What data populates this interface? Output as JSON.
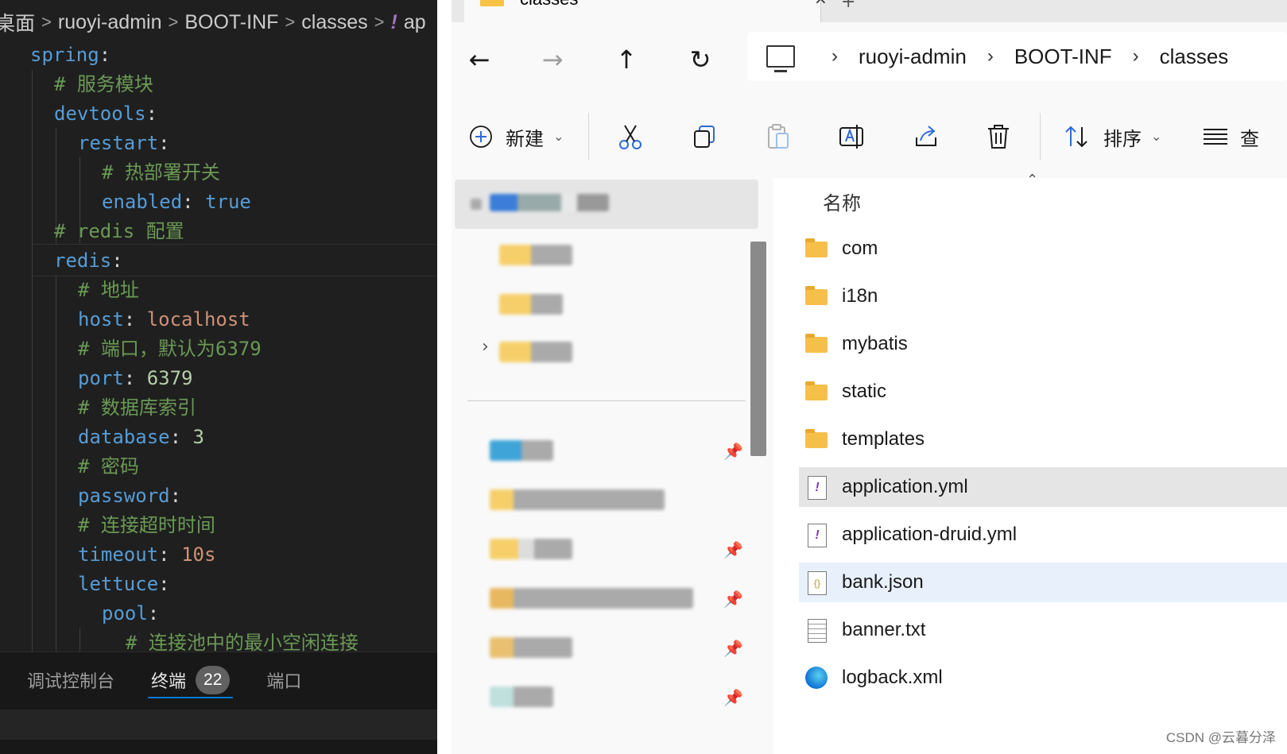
{
  "editor": {
    "breadcrumb": [
      "桌面",
      "ruoyi-admin",
      "BOOT-INF",
      "classes",
      "ap"
    ],
    "breadcrumb_sep": ">",
    "yml_icon": "!",
    "lines": [
      {
        "indent": 1,
        "parts": [
          [
            "k",
            "spring"
          ],
          [
            "p",
            ":"
          ]
        ]
      },
      {
        "indent": 2,
        "parts": [
          [
            "c",
            "# 服务模块"
          ]
        ]
      },
      {
        "indent": 2,
        "parts": [
          [
            "k",
            "devtools"
          ],
          [
            "p",
            ":"
          ]
        ]
      },
      {
        "indent": 3,
        "parts": [
          [
            "k",
            "restart"
          ],
          [
            "p",
            ":"
          ]
        ]
      },
      {
        "indent": 4,
        "parts": [
          [
            "c",
            "# 热部署开关"
          ]
        ]
      },
      {
        "indent": 4,
        "parts": [
          [
            "k",
            "enabled"
          ],
          [
            "p",
            ": "
          ],
          [
            "b",
            "true"
          ]
        ]
      },
      {
        "indent": 2,
        "parts": [
          [
            "c",
            "# redis 配置"
          ]
        ]
      },
      {
        "indent": 2,
        "parts": [
          [
            "k",
            "redis"
          ],
          [
            "p",
            ":"
          ]
        ]
      },
      {
        "indent": 3,
        "parts": [
          [
            "c",
            "# 地址"
          ]
        ]
      },
      {
        "indent": 3,
        "parts": [
          [
            "k",
            "host"
          ],
          [
            "p",
            ": "
          ],
          [
            "s",
            "localhost"
          ]
        ]
      },
      {
        "indent": 3,
        "parts": [
          [
            "c",
            "# 端口，默认为6379"
          ]
        ]
      },
      {
        "indent": 3,
        "parts": [
          [
            "k",
            "port"
          ],
          [
            "p",
            ": "
          ],
          [
            "n",
            "6379"
          ]
        ]
      },
      {
        "indent": 3,
        "parts": [
          [
            "c",
            "# 数据库索引"
          ]
        ]
      },
      {
        "indent": 3,
        "parts": [
          [
            "k",
            "database"
          ],
          [
            "p",
            ": "
          ],
          [
            "n",
            "3"
          ]
        ]
      },
      {
        "indent": 3,
        "parts": [
          [
            "c",
            "# 密码"
          ]
        ]
      },
      {
        "indent": 3,
        "parts": [
          [
            "k",
            "password"
          ],
          [
            "p",
            ":"
          ]
        ]
      },
      {
        "indent": 3,
        "parts": [
          [
            "c",
            "# 连接超时时间"
          ]
        ]
      },
      {
        "indent": 3,
        "parts": [
          [
            "k",
            "timeout"
          ],
          [
            "p",
            ": "
          ],
          [
            "s",
            "10s"
          ]
        ]
      },
      {
        "indent": 3,
        "parts": [
          [
            "k",
            "lettuce"
          ],
          [
            "p",
            ":"
          ]
        ]
      },
      {
        "indent": 4,
        "parts": [
          [
            "k",
            "pool"
          ],
          [
            "p",
            ":"
          ]
        ]
      },
      {
        "indent": 5,
        "parts": [
          [
            "c",
            "# 连接池中的最小空闲连接"
          ]
        ]
      }
    ],
    "panel": {
      "tabs": [
        {
          "label": "调试控制台",
          "active": false
        },
        {
          "label": "终端",
          "active": true,
          "badge": "22"
        },
        {
          "label": "端口",
          "active": false
        }
      ]
    }
  },
  "explorer": {
    "tab_title": "classes",
    "tab_close": "×",
    "tab_new": "+",
    "nav": {
      "back": "←",
      "forward": "→",
      "up": "↑",
      "refresh": "↻"
    },
    "address": [
      "ruoyi-admin",
      "BOOT-INF",
      "classes"
    ],
    "address_sep": "›",
    "commands": {
      "new_label": "新建",
      "sort_label": "排序",
      "view_label": "查"
    },
    "column_header": "名称",
    "files": [
      {
        "name": "com",
        "type": "folder"
      },
      {
        "name": "i18n",
        "type": "folder"
      },
      {
        "name": "mybatis",
        "type": "folder"
      },
      {
        "name": "static",
        "type": "folder"
      },
      {
        "name": "templates",
        "type": "folder"
      },
      {
        "name": "application.yml",
        "type": "yml",
        "state": "selected"
      },
      {
        "name": "application-druid.yml",
        "type": "yml"
      },
      {
        "name": "bank.json",
        "type": "json",
        "state": "hover"
      },
      {
        "name": "banner.txt",
        "type": "txt"
      },
      {
        "name": "logback.xml",
        "type": "edge"
      }
    ],
    "watermark": "CSDN @云暮分泽"
  },
  "colors": {
    "editor_bg": "#1f1f1f",
    "keyword": "#569cd6",
    "comment": "#6a9955",
    "string": "#ce9178",
    "number": "#b5cea8",
    "accent": "#0078d4",
    "folder": "#f5c04a"
  }
}
